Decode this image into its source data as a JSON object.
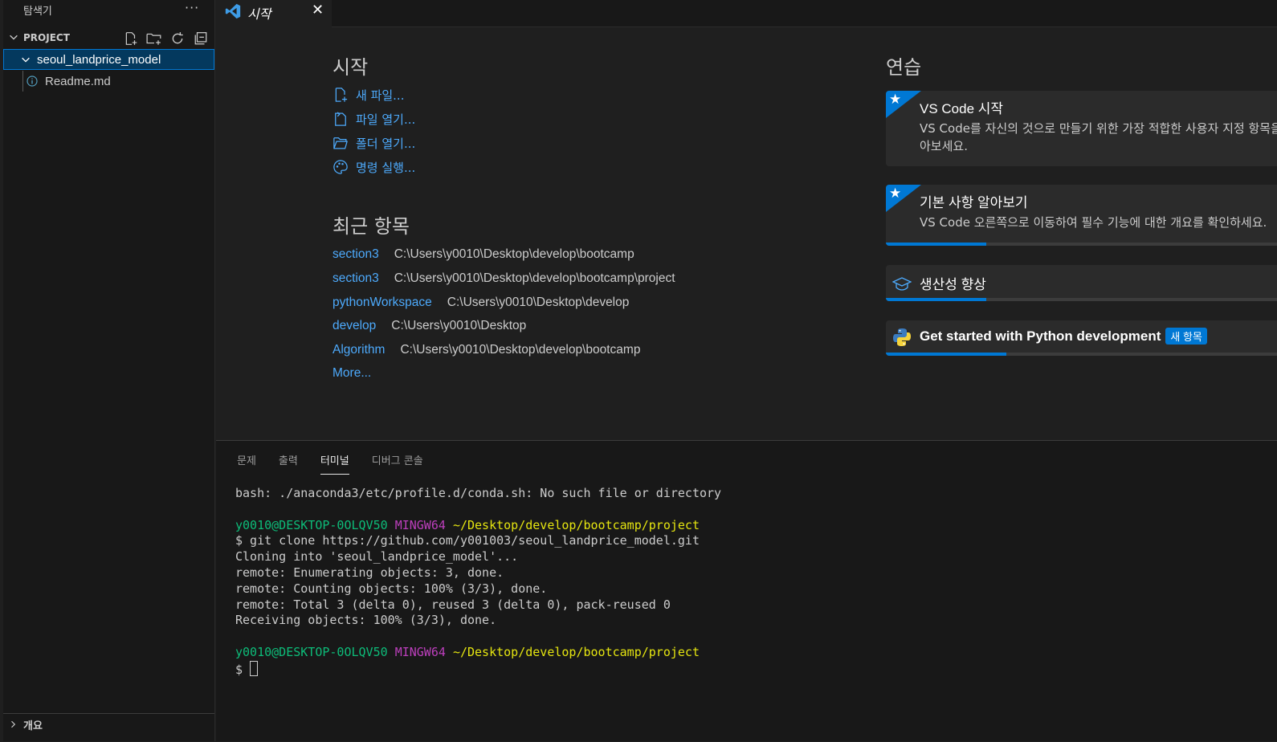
{
  "sidebar": {
    "title": "탐색기",
    "more": "···",
    "section_label": "PROJECT",
    "folder": "seoul_landprice_model",
    "file": "Readme.md",
    "outline_label": "개요",
    "actions": [
      "new-file-icon",
      "new-folder-icon",
      "refresh-icon",
      "collapse-all-icon"
    ]
  },
  "tabs": [
    {
      "label": "시작",
      "icon": "vscode-logo-icon",
      "close": "✕"
    }
  ],
  "welcome": {
    "start_heading": "시작",
    "start_items": [
      {
        "label": "새 파일...",
        "icon": "new-file-icon"
      },
      {
        "label": "파일 열기...",
        "icon": "open-file-icon"
      },
      {
        "label": "폴더 열기...",
        "icon": "open-folder-icon"
      },
      {
        "label": "명령 실행...",
        "icon": "palette-icon"
      }
    ],
    "recent_heading": "최근 항목",
    "recent": [
      {
        "name": "section3",
        "path": "C:\\Users\\y0010\\Desktop\\develop\\bootcamp"
      },
      {
        "name": "section3",
        "path": "C:\\Users\\y0010\\Desktop\\develop\\bootcamp\\project"
      },
      {
        "name": "pythonWorkspace",
        "path": "C:\\Users\\y0010\\Desktop\\develop"
      },
      {
        "name": "develop",
        "path": "C:\\Users\\y0010\\Desktop"
      },
      {
        "name": "Algorithm",
        "path": "C:\\Users\\y0010\\Desktop\\develop\\bootcamp"
      }
    ],
    "more": "More...",
    "walkthrough_heading": "연습",
    "walkthroughs": [
      {
        "title": "VS Code 시작",
        "desc": "VS Code를 자신의 것으로 만들기 위한 가장 적합한 사용자 지정 항목을 찾아보세요.",
        "progress": 0
      },
      {
        "title": "기본 사항 알아보기",
        "desc": "VS Code 오른쪽으로 이동하여 필수 기능에 대한 개요를 확인하세요.",
        "progress": 0.25
      },
      {
        "title": "생산성 향상",
        "progress": 0.25
      },
      {
        "title": "Get started with Python development",
        "badge": "새 항목",
        "progress": 0.3
      }
    ]
  },
  "panel": {
    "tabs": [
      "문제",
      "출력",
      "터미널",
      "디버그 콘솔"
    ],
    "active_tab": "터미널",
    "terminal": {
      "line1": "bash: ./anaconda3/etc/profile.d/conda.sh: No such file or directory",
      "user": "y0010@DESKTOP-0OLQV50",
      "shell": "MINGW64",
      "cwd": "~/Desktop/develop/bootcamp/project",
      "cmd": "$ git clone https://github.com/y001003/seoul_landprice_model.git",
      "out1": "Cloning into 'seoul_landprice_model'...",
      "out2": "remote: Enumerating objects: 3, done.",
      "out3": "remote: Counting objects: 100% (3/3), done.",
      "out4": "remote: Total 3 (delta 0), reused 3 (delta 0), pack-reused 0",
      "out5": "Receiving objects: 100% (3/3), done.",
      "prompt": "$ "
    }
  },
  "colors": {
    "accent": "#0078d4",
    "link": "#4daafc",
    "term_green": "#0dbc79",
    "term_magenta": "#bc3fbc",
    "term_yellow": "#e5e510"
  }
}
